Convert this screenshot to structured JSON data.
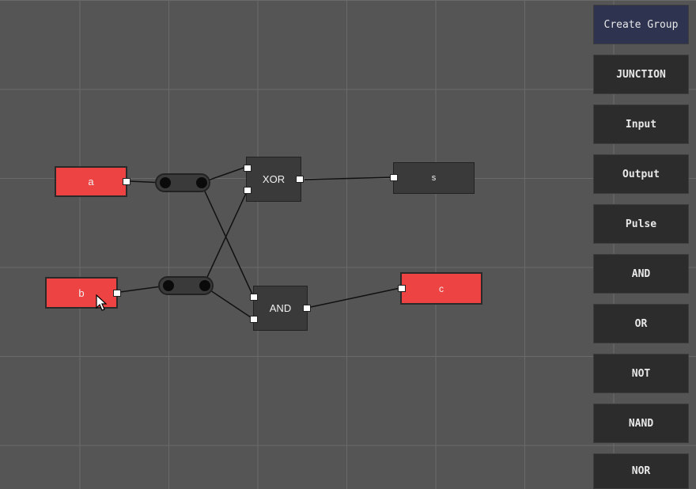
{
  "nodes": {
    "input_a": "a",
    "input_b": "b",
    "xor": "XOR",
    "and": "AND",
    "output_s": "s",
    "output_c": "c"
  },
  "sidebar": {
    "create_group": "Create Group",
    "items": [
      "JUNCTION",
      "Input",
      "Output",
      "Pulse",
      "AND",
      "OR",
      "NOT",
      "NAND",
      "NOR"
    ]
  },
  "colors": {
    "active": "#ee4343",
    "node": "#3a3a3a",
    "canvas": "#555555",
    "panel": "#2c2c2c",
    "primary_button": "#2e3350"
  }
}
